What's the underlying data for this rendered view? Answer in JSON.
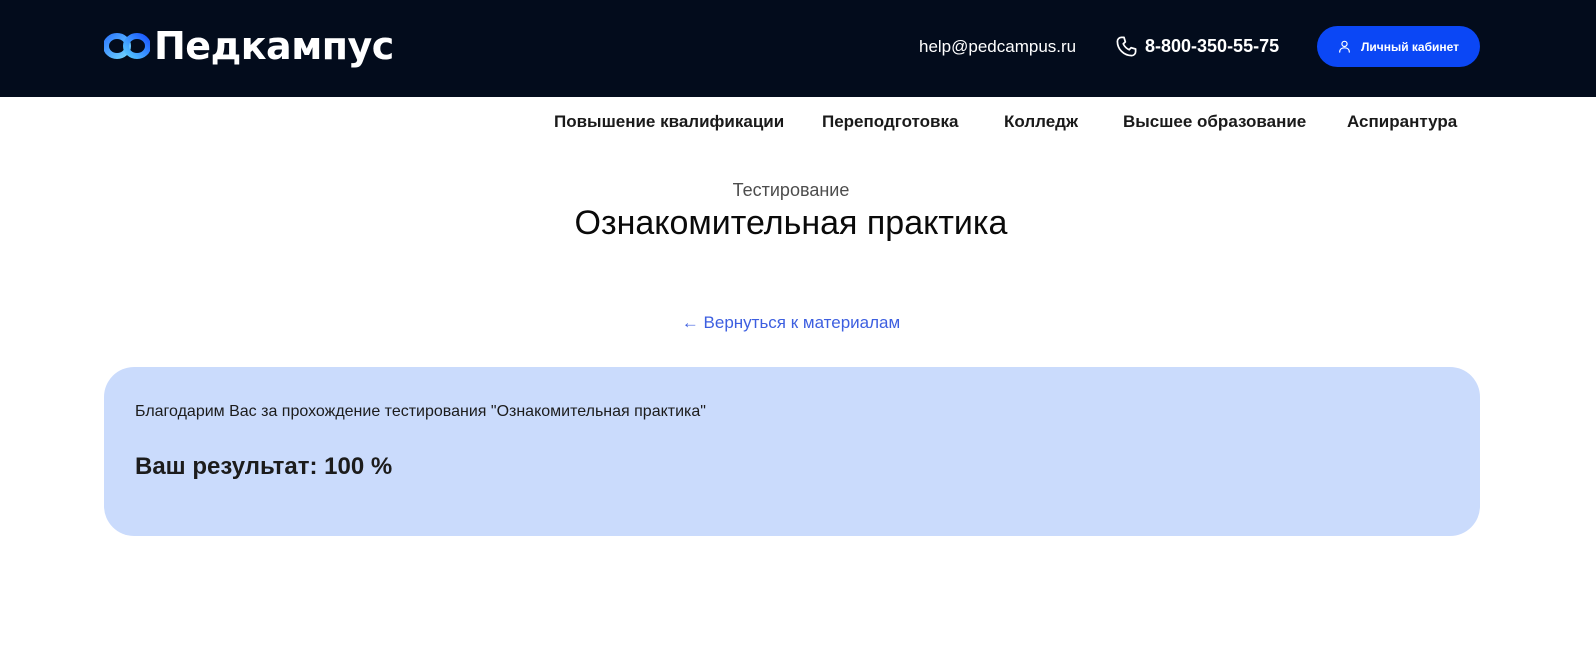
{
  "header": {
    "logo_text": "Педкампус",
    "email": "help@pedcampus.ru",
    "phone": "8-800-350-55-75",
    "cabinet_button": "Личный кабинет",
    "accent_color": "#0b47f5",
    "background_color": "#030c1c"
  },
  "nav": {
    "items": [
      {
        "label": "Повышение квалификации"
      },
      {
        "label": "Переподготовка"
      },
      {
        "label": "Колледж"
      },
      {
        "label": "Высшее образование"
      },
      {
        "label": "Аспирантура"
      }
    ]
  },
  "page": {
    "subtitle": "Тестирование",
    "title": "Ознакомительная практика",
    "back_link": "← Вернуться к материалам"
  },
  "result": {
    "thanks_text": "Благодарим Вас за прохождение тестирования \"Ознакомительная практика\"",
    "score_text": "Ваш результат: 100 %",
    "card_color": "#cadbfc"
  },
  "icons": {
    "logo": "infinity-wave-logo-icon",
    "phone": "phone-icon",
    "user": "user-icon"
  }
}
